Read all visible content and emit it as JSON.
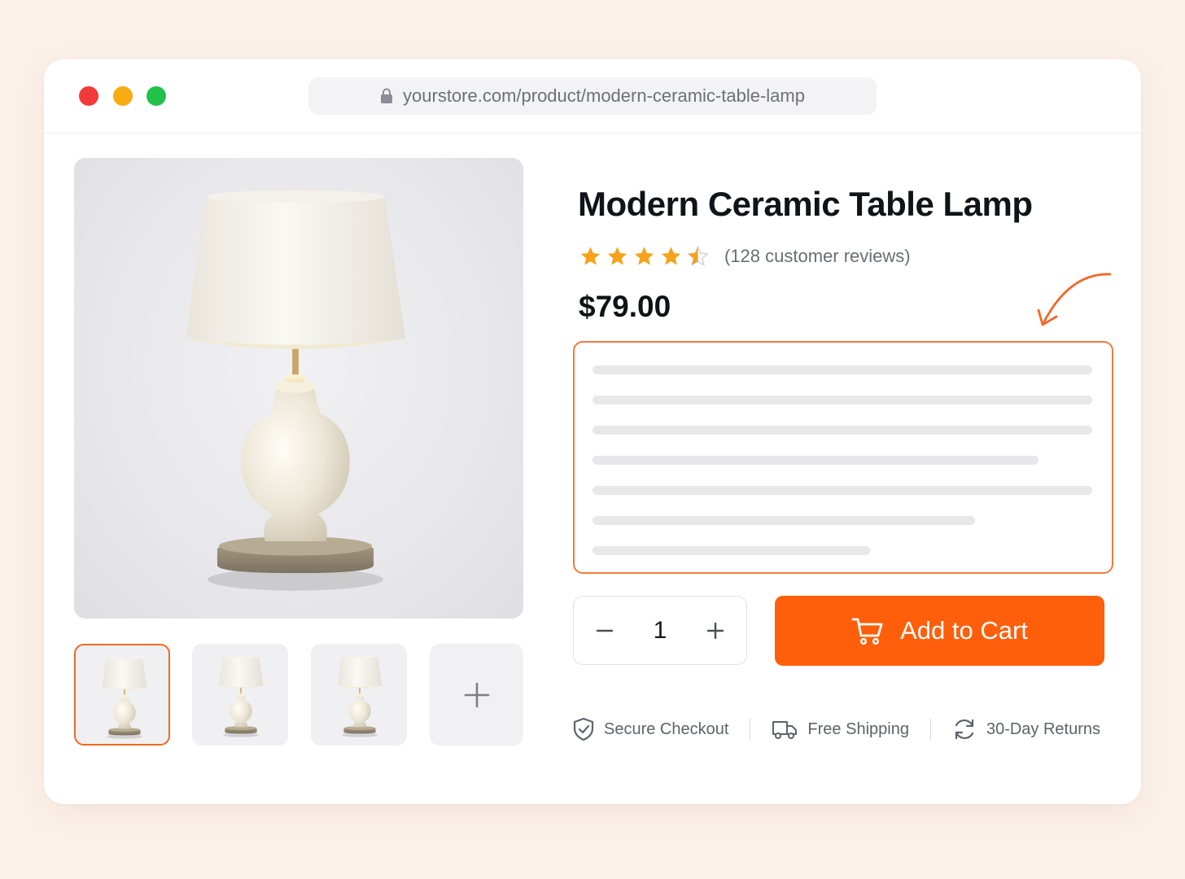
{
  "browser": {
    "url": "yourstore.com/product/modern-ceramic-table-lamp"
  },
  "product": {
    "title": "Modern Ceramic Table Lamp",
    "rating": 4.5,
    "rating_max": 5,
    "review_count_text": "(128 customer reviews)",
    "price": "$79.00",
    "quantity": "1",
    "add_to_cart_label": "Add to Cart"
  },
  "gallery": {
    "thumbnail_count": 3,
    "selected_index": 0,
    "more_icon": "plus-icon"
  },
  "badges": [
    {
      "icon": "shield-check-icon",
      "label": "Secure Checkout"
    },
    {
      "icon": "truck-icon",
      "label": "Free Shipping"
    },
    {
      "icon": "refresh-icon",
      "label": "30-Day Returns"
    }
  ],
  "colors": {
    "accent": "#ff5f0a",
    "highlight_border": "#f07c3c",
    "star": "#f7a21a"
  }
}
